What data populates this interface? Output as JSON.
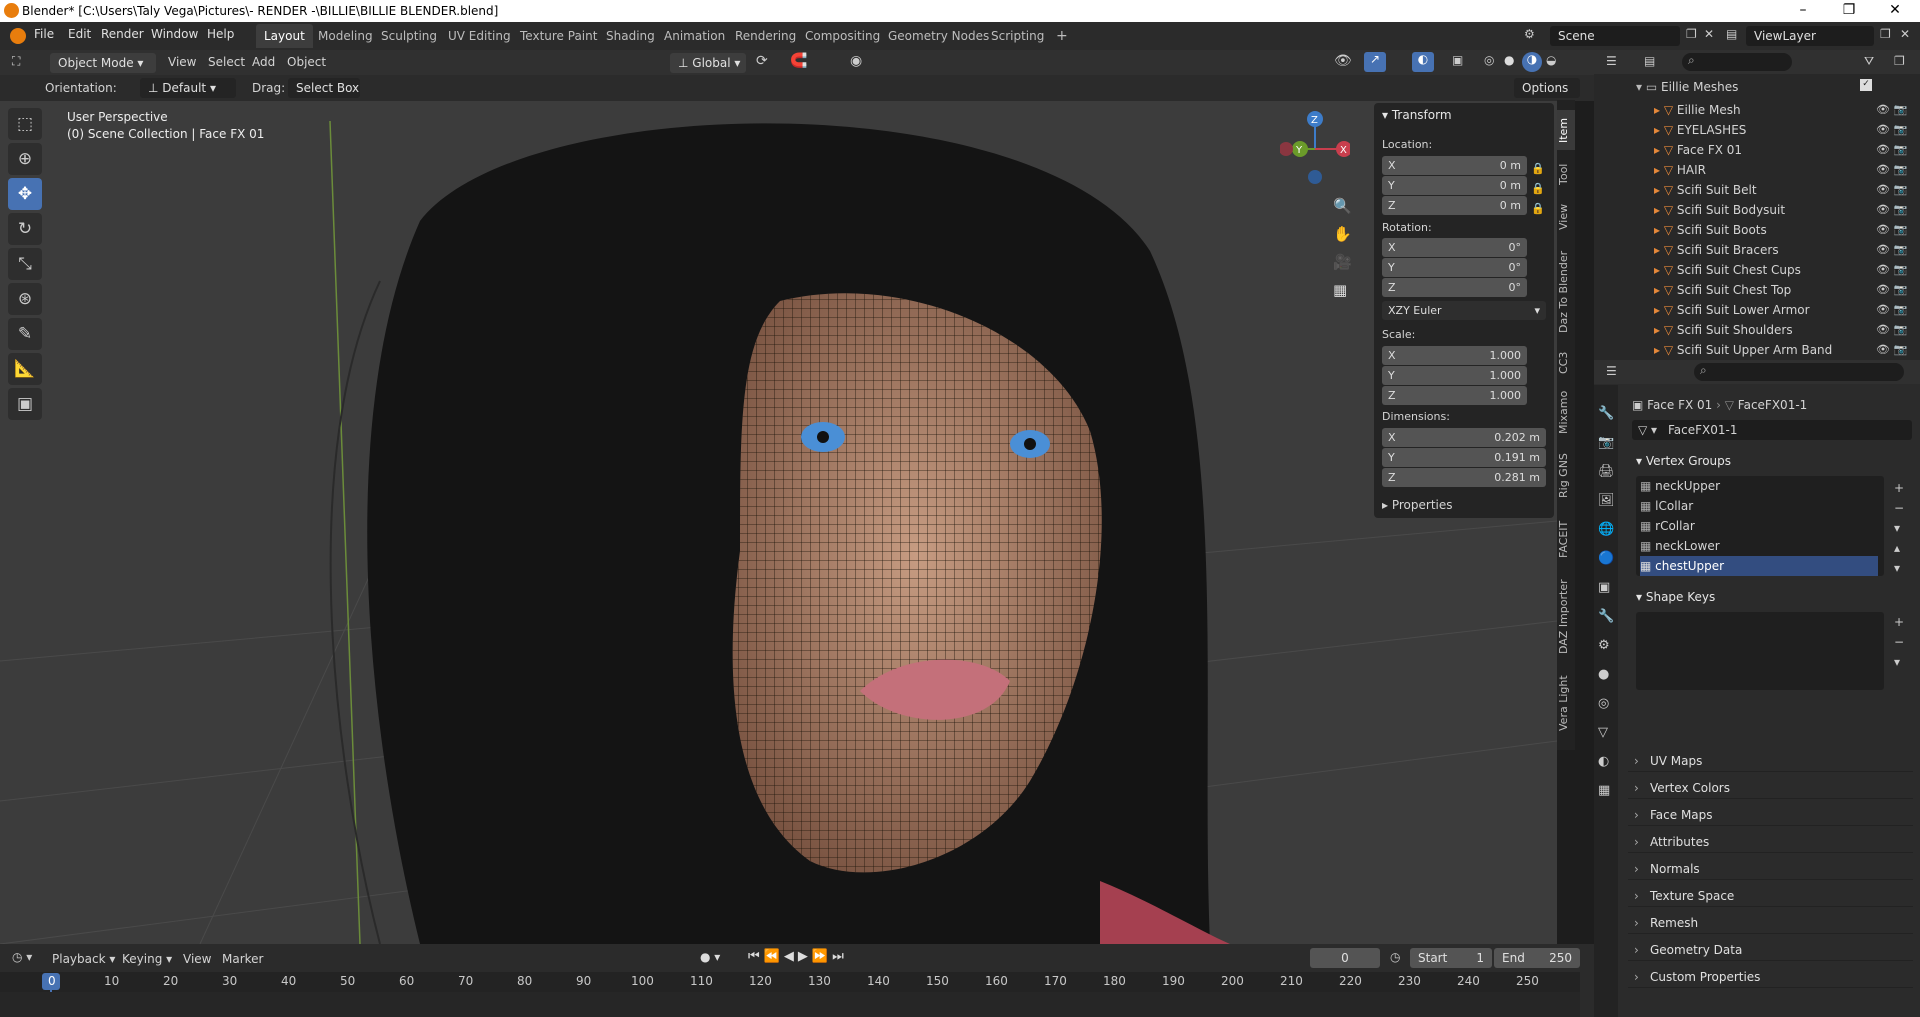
{
  "window": {
    "title": "Blender* [C:\\Users\\Taly Vega\\Pictures\\- RENDER -\\BILLIE\\BILLIE BLENDER.blend]",
    "min": "–",
    "max": "❐",
    "close": "✕"
  },
  "menus": [
    "File",
    "Edit",
    "Render",
    "Window",
    "Help"
  ],
  "workspaces": [
    "Layout",
    "Modeling",
    "Sculpting",
    "UV Editing",
    "Texture Paint",
    "Shading",
    "Animation",
    "Rendering",
    "Compositing",
    "Geometry Nodes",
    "Scripting",
    "+"
  ],
  "scene": {
    "label": "Scene",
    "view_layer": "ViewLayer"
  },
  "viewport_header": {
    "mode": "Object Mode",
    "menus": [
      "View",
      "Select",
      "Add",
      "Object"
    ],
    "transform": "Global",
    "orientation_label": "Orientation:",
    "orientation_value": "Default",
    "drag_label": "Drag:",
    "drag_value": "Select Box",
    "options": "Options"
  },
  "overlay": {
    "perspective": "User Perspective",
    "collection": "(0) Scene Collection | Face FX 01"
  },
  "gizmo": {
    "x": "X",
    "y": "Y",
    "z": "Z"
  },
  "npanel": {
    "title": "Transform",
    "location": "Location:",
    "loc": [
      {
        "axis": "X",
        "val": "0 m"
      },
      {
        "axis": "Y",
        "val": "0 m"
      },
      {
        "axis": "Z",
        "val": "0 m"
      }
    ],
    "rotation": "Rotation:",
    "rot": [
      {
        "axis": "X",
        "val": "0°"
      },
      {
        "axis": "Y",
        "val": "0°"
      },
      {
        "axis": "Z",
        "val": "0°"
      }
    ],
    "rot_mode": "XZY Euler",
    "scale": "Scale:",
    "scl": [
      {
        "axis": "X",
        "val": "1.000"
      },
      {
        "axis": "Y",
        "val": "1.000"
      },
      {
        "axis": "Z",
        "val": "1.000"
      }
    ],
    "dimensions": "Dimensions:",
    "dim": [
      {
        "axis": "X",
        "val": "0.202 m"
      },
      {
        "axis": "Y",
        "val": "0.191 m"
      },
      {
        "axis": "Z",
        "val": "0.281 m"
      }
    ],
    "properties": "Properties"
  },
  "side_tabs": [
    "Item",
    "Tool",
    "View",
    "Daz To Blender",
    "CC3",
    "Mixamo",
    "Rig GNS",
    "FACEIT",
    "DAZ Importer",
    "Vera Light"
  ],
  "outliner": {
    "collection": "Eillie Meshes",
    "items": [
      "Eillie Mesh",
      "EYELASHES",
      "Face FX 01",
      "HAIR",
      "Scifi Suit Belt",
      "Scifi Suit Bodysuit",
      "Scifi Suit Boots",
      "Scifi Suit Bracers",
      "Scifi Suit Chest Cups",
      "Scifi Suit Chest Top",
      "Scifi Suit Lower Armor",
      "Scifi Suit Shoulders",
      "Scifi Suit Upper Arm Band"
    ]
  },
  "properties": {
    "breadcrumb_obj": "Face FX 01",
    "breadcrumb_data": "FaceFX01-1",
    "mesh_name": "FaceFX01-1",
    "vertex_groups_title": "Vertex Groups",
    "vertex_groups": [
      "neckUpper",
      "lCollar",
      "rCollar",
      "neckLower",
      "chestUpper"
    ],
    "shape_keys_title": "Shape Keys",
    "sections": [
      "UV Maps",
      "Vertex Colors",
      "Face Maps",
      "Attributes",
      "Normals",
      "Texture Space",
      "Remesh",
      "Geometry Data",
      "Custom Properties"
    ]
  },
  "timeline": {
    "menus": [
      "Playback",
      "Keying",
      "View",
      "Marker"
    ],
    "current": "0",
    "start_label": "Start",
    "start": "1",
    "end_label": "End",
    "end": "250",
    "ticks": [
      "0",
      "10",
      "20",
      "30",
      "40",
      "50",
      "60",
      "70",
      "80",
      "90",
      "100",
      "110",
      "120",
      "130",
      "140",
      "150",
      "160",
      "170",
      "180",
      "190",
      "200",
      "210",
      "220",
      "230",
      "240",
      "250"
    ]
  }
}
